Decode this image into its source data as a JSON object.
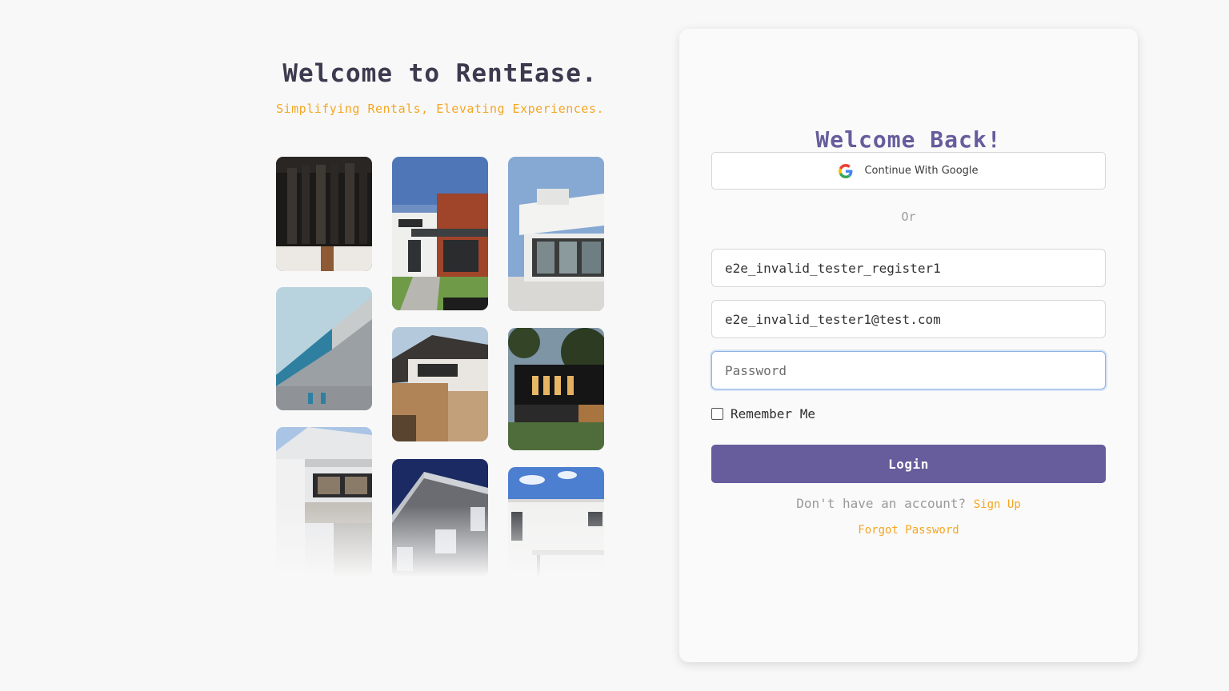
{
  "hero": {
    "title": "Welcome to RentEase.",
    "subtitle": "Simplifying Rentals, Elevating Experiences."
  },
  "gallery": {
    "photos": [
      "dark-slatted-building",
      "modern-house-red-cladding",
      "white-house-glass-doors",
      "angular-facade-building",
      "timber-house",
      "black-house-lit-windows",
      "white-apartment-balcony",
      "dark-tiled-corner-building",
      "white-flat-roof-house"
    ]
  },
  "login": {
    "title": "Welcome Back!",
    "google_label": "Continue With Google",
    "or_label": "Or",
    "username_value": "e2e_invalid_tester_register1",
    "email_value": "e2e_invalid_tester1@test.com",
    "password_placeholder": "Password",
    "remember_label": "Remember Me",
    "remember_checked": false,
    "login_label": "Login",
    "no_account_text": "Don't have an account?",
    "signup_label": "Sign Up",
    "forgot_label": "Forgot Password"
  },
  "colors": {
    "accent": "#675c9c",
    "highlight": "#f5a623",
    "title": "#3d3a4f"
  }
}
